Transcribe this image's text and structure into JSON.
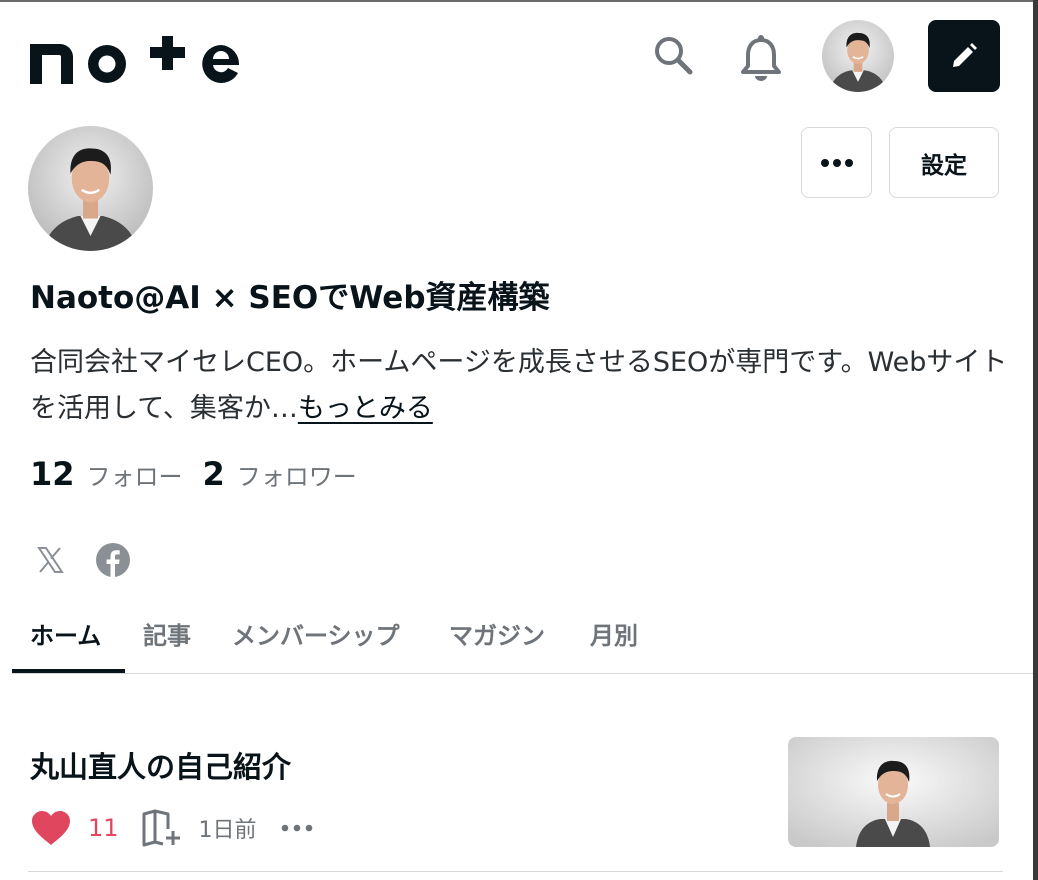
{
  "header": {
    "logo_text": "note",
    "icons": [
      "search-icon",
      "bell-icon",
      "user-avatar",
      "pencil-icon"
    ]
  },
  "profile": {
    "name": "Naoto@AI × SEOでWeb資産構築",
    "bio_text": "合同会社マイセレCEO。ホームページを成長させるSEOが専門です。Webサイトを活用して、集客か…",
    "bio_more": "もっとみる",
    "following_count": "12",
    "following_label": "フォロー",
    "followers_count": "2",
    "followers_label": "フォロワー",
    "settings_label": "設定",
    "more_label": "•••"
  },
  "social": [
    "x-icon",
    "facebook-icon"
  ],
  "tabs": [
    {
      "label": "ホーム",
      "active": true
    },
    {
      "label": "記事",
      "active": false
    },
    {
      "label": "メンバーシップ",
      "active": false
    },
    {
      "label": "マガジン",
      "active": false
    },
    {
      "label": "月別",
      "active": false
    }
  ],
  "articles": [
    {
      "title": "丸山直人の自己紹介",
      "likes": "11",
      "time": "1日前"
    }
  ],
  "colors": {
    "text": "#08131a",
    "muted": "#6e7479",
    "like": "#e0465e",
    "border": "#d6d9dc"
  }
}
